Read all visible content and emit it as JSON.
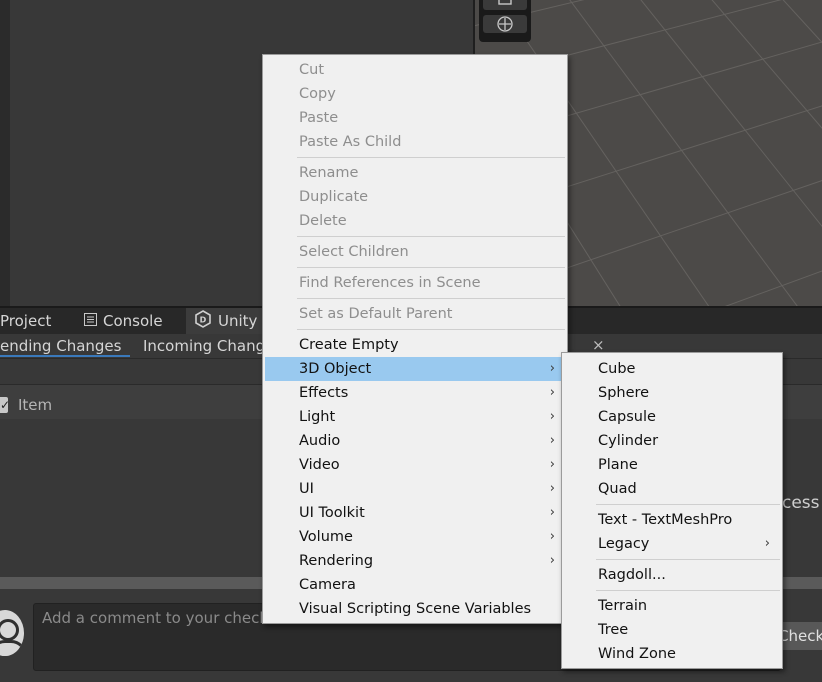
{
  "colors": {
    "menu_bg": "#f0f0f0",
    "menu_highlight": "#99c9ef",
    "editor_bg": "#383838",
    "tab_underline": "#3a79bb"
  },
  "tabs": {
    "project": "Project",
    "console": "Console",
    "unity": "Unity"
  },
  "subtabs": {
    "pending": "ending Changes",
    "incoming": "Incoming Change"
  },
  "close_glyph": "×",
  "list": {
    "item_header": "Item",
    "right_clipped_text": "cess"
  },
  "comment": {
    "placeholder": "Add a comment to your check-"
  },
  "checkin_button": "Check",
  "context_menu": {
    "items": {
      "cut": "Cut",
      "copy": "Copy",
      "paste": "Paste",
      "paste_as_child": "Paste As Child",
      "rename": "Rename",
      "duplicate": "Duplicate",
      "delete": "Delete",
      "select_children": "Select Children",
      "find_references": "Find References in Scene",
      "set_default_parent": "Set as Default Parent",
      "create_empty": "Create Empty",
      "object_3d": "3D Object",
      "effects": "Effects",
      "light": "Light",
      "audio": "Audio",
      "video": "Video",
      "ui": "UI",
      "ui_toolkit": "UI Toolkit",
      "volume": "Volume",
      "rendering": "Rendering",
      "camera": "Camera",
      "visual_scripting": "Visual Scripting Scene Variables"
    },
    "disabled": [
      "cut",
      "copy",
      "paste",
      "paste_as_child",
      "rename",
      "duplicate",
      "delete",
      "select_children",
      "find_references",
      "set_default_parent"
    ],
    "selected": "object_3d"
  },
  "submenu_3d_object": {
    "cube": "Cube",
    "sphere": "Sphere",
    "capsule": "Capsule",
    "cylinder": "Cylinder",
    "plane": "Plane",
    "quad": "Quad",
    "text_mesh_pro": "Text - TextMeshPro",
    "legacy": "Legacy",
    "ragdoll": "Ragdoll...",
    "terrain": "Terrain",
    "tree": "Tree",
    "wind_zone": "Wind Zone"
  },
  "submenu_arrow": "›"
}
